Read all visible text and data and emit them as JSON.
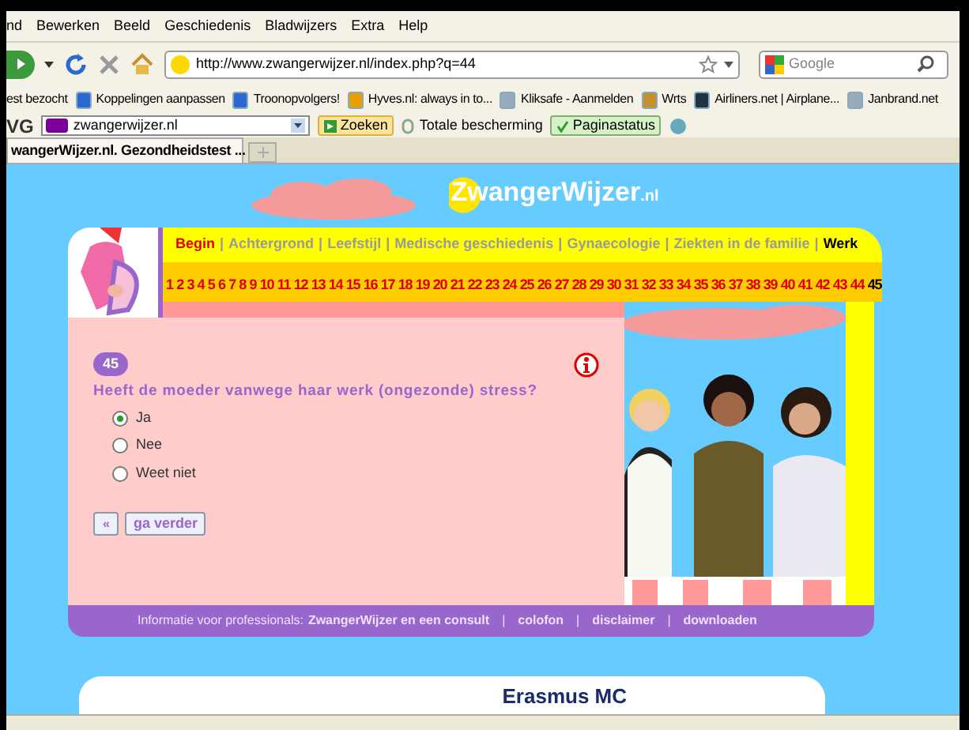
{
  "menu": [
    "nd",
    "Bewerken",
    "Beeld",
    "Geschiedenis",
    "Bladwijzers",
    "Extra",
    "Help"
  ],
  "address": {
    "value": "http://www.zwangerwijzer.nl/index.php?q=44"
  },
  "search": {
    "placeholder": "Google"
  },
  "bookmarks": [
    "est bezocht",
    "Koppelingen aanpassen",
    "Troonopvolgers!",
    "Hyves.nl: always in to...",
    "Kliksafe - Aanmelden",
    "Wrts",
    "Airliners.net | Airplane...",
    "Janbrand.net"
  ],
  "toolbar": {
    "brand": "VG",
    "field": "zwangerwijzer.nl",
    "search_button": "Zoeken",
    "protection": "Totale bescherming",
    "status_button": "Paginastatus"
  },
  "tab": {
    "title": "wangerWijzer.nl. Gezondheidstest ..."
  },
  "site": {
    "logo": "ZwangerWijzer",
    "logo_suffix": ".nl",
    "sections": [
      {
        "label": "Begin",
        "selected": false,
        "disabled": false
      },
      {
        "label": "Achtergrond",
        "selected": false,
        "disabled": true
      },
      {
        "label": "Leefstijl",
        "selected": false,
        "disabled": true
      },
      {
        "label": "Medische geschiedenis",
        "selected": false,
        "disabled": true
      },
      {
        "label": "Gynaecologie",
        "selected": false,
        "disabled": true
      },
      {
        "label": "Ziekten in de familie",
        "selected": false,
        "disabled": true
      },
      {
        "label": "Werk",
        "selected": true,
        "disabled": false
      }
    ],
    "separator": "|",
    "numbers": [
      {
        "label": "1",
        "selected": false
      },
      {
        "label": "2",
        "selected": false
      },
      {
        "label": "3",
        "selected": false
      },
      {
        "label": "4",
        "selected": false
      },
      {
        "label": "5",
        "selected": false
      },
      {
        "label": "6",
        "selected": false
      },
      {
        "label": "7",
        "selected": false
      },
      {
        "label": "8",
        "selected": false
      },
      {
        "label": "9",
        "selected": false
      },
      {
        "label": "10",
        "selected": false
      },
      {
        "label": "11",
        "selected": false
      },
      {
        "label": "12",
        "selected": false
      },
      {
        "label": "13",
        "selected": false
      },
      {
        "label": "14",
        "selected": false
      },
      {
        "label": "15",
        "selected": false
      },
      {
        "label": "16",
        "selected": false
      },
      {
        "label": "17",
        "selected": false
      },
      {
        "label": "18",
        "selected": false
      },
      {
        "label": "19",
        "selected": false
      },
      {
        "label": "20",
        "selected": false
      },
      {
        "label": "21",
        "selected": false
      },
      {
        "label": "22",
        "selected": false
      },
      {
        "label": "23",
        "selected": false
      },
      {
        "label": "24",
        "selected": false
      },
      {
        "label": "25",
        "selected": false
      },
      {
        "label": "26",
        "selected": false
      },
      {
        "label": "27",
        "selected": false
      },
      {
        "label": "28",
        "selected": false
      },
      {
        "label": "29",
        "selected": false
      },
      {
        "label": "30",
        "selected": false
      },
      {
        "label": "31",
        "selected": false
      },
      {
        "label": "32",
        "selected": false
      },
      {
        "label": "33",
        "selected": false
      },
      {
        "label": "34",
        "selected": false
      },
      {
        "label": "35",
        "selected": false
      },
      {
        "label": "36",
        "selected": false
      },
      {
        "label": "37",
        "selected": false
      },
      {
        "label": "38",
        "selected": false
      },
      {
        "label": "39",
        "selected": false
      },
      {
        "label": "40",
        "selected": false
      },
      {
        "label": "41",
        "selected": false
      },
      {
        "label": "42",
        "selected": false
      },
      {
        "label": "43",
        "selected": false
      },
      {
        "label": "44",
        "selected": false
      },
      {
        "label": "45",
        "selected": true
      }
    ],
    "question_number": "45",
    "question": "Heeft de moeder vanwege haar werk (ongezonde) stress?",
    "options": [
      {
        "label": "Ja",
        "selected": true
      },
      {
        "label": "Nee",
        "selected": false
      },
      {
        "label": "Weet niet",
        "selected": false
      }
    ],
    "back_button": "«",
    "next_button": "ga verder",
    "footer": {
      "separators": [
        "|",
        "|",
        "|"
      ],
      "intro": "Informatie voor professionals:",
      "links": [
        "ZwangerWijzer en een consult",
        "colofon",
        "disclaimer",
        "downloaden"
      ]
    },
    "partner": "Erasmus MC"
  }
}
